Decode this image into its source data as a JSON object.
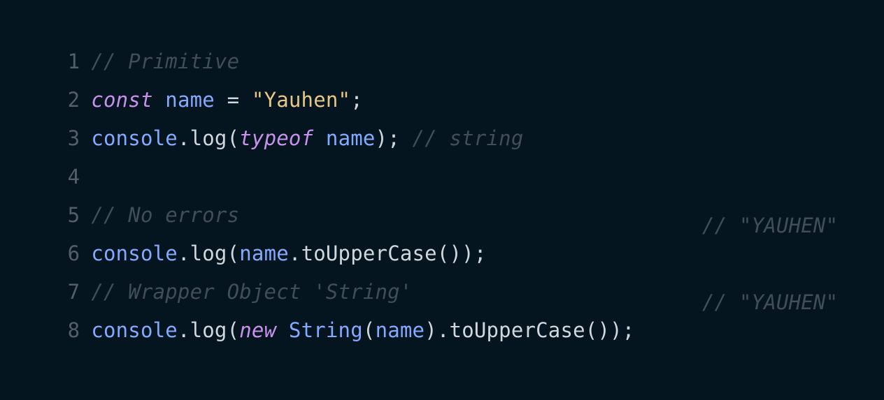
{
  "editor": {
    "lines": [
      {
        "number": "1",
        "comment": "// Primitive"
      },
      {
        "number": "2",
        "kw": "const",
        "var": "name",
        "op": " = ",
        "str": "\"Yauhen\"",
        "end": ";"
      },
      {
        "number": "3",
        "obj": "console",
        "dot": ".",
        "fn": "log",
        "open": "(",
        "kw": "typeof",
        "var": "name",
        "close": ");",
        "comment": "// string"
      },
      {
        "number": "4"
      },
      {
        "number": "5",
        "comment": "// No errors"
      },
      {
        "number": "6",
        "obj": "console",
        "dot": ".",
        "fn": "log",
        "open": "(",
        "var": "name",
        "dot2": ".",
        "method": "toUpperCase",
        "close": "());",
        "comment": "// \"YAUHEN\""
      },
      {
        "number": "7",
        "comment": "// Wrapper Object 'String'"
      },
      {
        "number": "8",
        "obj": "console",
        "dot": ".",
        "fn": "log",
        "open": "(",
        "kw": "new",
        "cls": "String",
        "open2": "(",
        "var": "name",
        "close2": ").",
        "method": "toUpperCase",
        "close": "());",
        "comment": "// \"YAUHEN\""
      }
    ]
  },
  "colors": {
    "background": "#051520",
    "line_number": "#525f69",
    "comment": "#414d57",
    "keyword": "#c792ea",
    "identifier": "#82aaff",
    "string": "#e8c786",
    "punctuation": "#d0d7dd"
  }
}
